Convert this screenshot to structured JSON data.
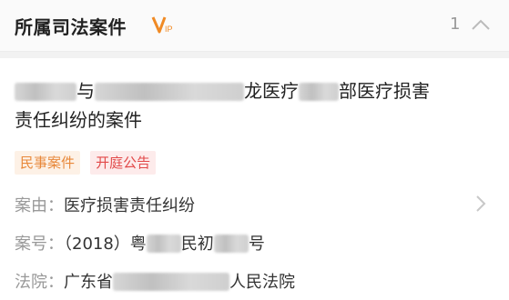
{
  "header": {
    "title": "所属司法案件",
    "vip_badge": "VIP",
    "count": "1",
    "collapse_icon": "chevron-up-icon"
  },
  "case": {
    "title_parts": {
      "p1": "与",
      "p2": "龙医疗",
      "p3": "部医疗损害",
      "p4": "责任纠纷的案件"
    },
    "tags": [
      "民事案件",
      "开庭公告"
    ],
    "cause_label": "案由：",
    "cause_value": "医疗损害责任纠纷",
    "number_label": "案号：",
    "number_parts": {
      "p1": "（2018）粤",
      "p2": "民初",
      "p3": "号"
    },
    "court_label": "法院：",
    "court_parts": {
      "p1": "广东省",
      "p2": "人民法院"
    }
  },
  "colors": {
    "tag_civil": "#e8883a",
    "tag_court": "#e24a4a",
    "vip_accent": "#f08a24"
  }
}
